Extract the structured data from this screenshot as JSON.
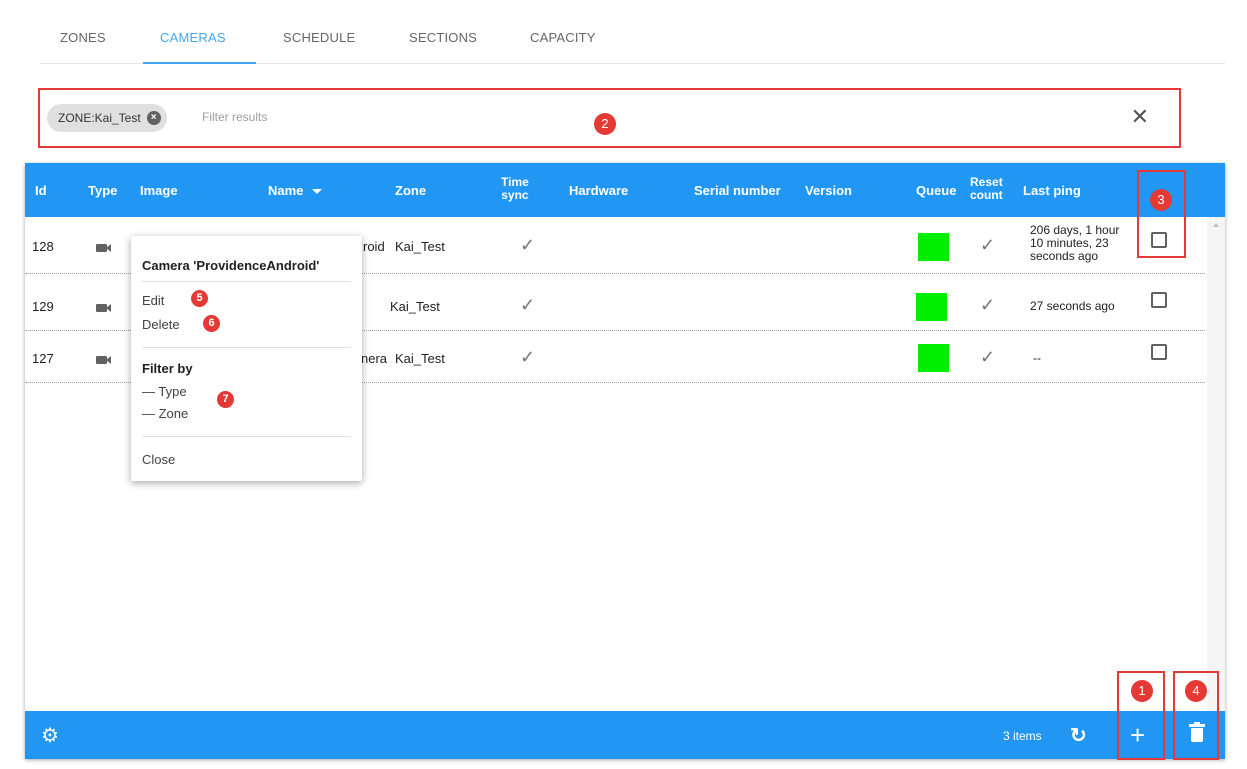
{
  "tabs": [
    {
      "label": "ZONES"
    },
    {
      "label": "CAMERAS"
    },
    {
      "label": "SCHEDULE"
    },
    {
      "label": "SECTIONS"
    },
    {
      "label": "CAPACITY"
    }
  ],
  "active_tab": "CAMERAS",
  "filter": {
    "chip_label": "ZONE:Kai_Test",
    "placeholder": "Filter results",
    "clear_icon": "close-icon"
  },
  "table": {
    "headers": {
      "id": "Id",
      "type": "Type",
      "image": "Image",
      "name": "Name",
      "zone": "Zone",
      "time_sync_1": "Time",
      "time_sync_2": "sync",
      "hardware": "Hardware",
      "serial": "Serial number",
      "version": "Version",
      "queue": "Queue",
      "reset_1": "Reset",
      "reset_2": "count",
      "last_ping": "Last ping"
    },
    "rows": [
      {
        "id": "128",
        "type_icon": "video-camera-icon",
        "name_visible": "roid",
        "zone": "Kai_Test",
        "time_sync": "✓",
        "queue_color": "#00ee00",
        "reset": "✓",
        "ping_1": "206 days, 1 hour",
        "ping_2": "10 minutes, 23",
        "ping_3": "seconds ago"
      },
      {
        "id": "129",
        "type_icon": "video-camera-icon",
        "name_visible": "",
        "zone": "Kai_Test",
        "time_sync": "✓",
        "queue_color": "#00ee00",
        "reset": "✓",
        "ping_1": "27 seconds ago"
      },
      {
        "id": "127",
        "type_icon": "video-camera-icon",
        "name_visible": "nera",
        "zone": "Kai_Test",
        "time_sync": "✓",
        "queue_color": "#00ee00",
        "reset": "✓",
        "ping_1": "--"
      }
    ]
  },
  "footer": {
    "items_count": "3 items",
    "settings_icon": "gear-icon",
    "refresh_icon": "refresh-icon",
    "add_icon": "plus-icon",
    "delete_icon": "trash-icon"
  },
  "context_menu": {
    "title": "Camera 'ProvidenceAndroid'",
    "edit": "Edit",
    "delete": "Delete",
    "filter_by": "Filter by",
    "filter_type": "— Type",
    "filter_zone": "— Zone",
    "close": "Close"
  },
  "annotations": {
    "b1": "1",
    "b2": "2",
    "b3": "3",
    "b4": "4",
    "b5": "5",
    "b6": "6",
    "b7": "7"
  },
  "colors": {
    "header_blue": "#2196f3",
    "tab_active": "#42a5f5",
    "annotation_red": "#e53935",
    "queue_green": "#00ee00"
  }
}
